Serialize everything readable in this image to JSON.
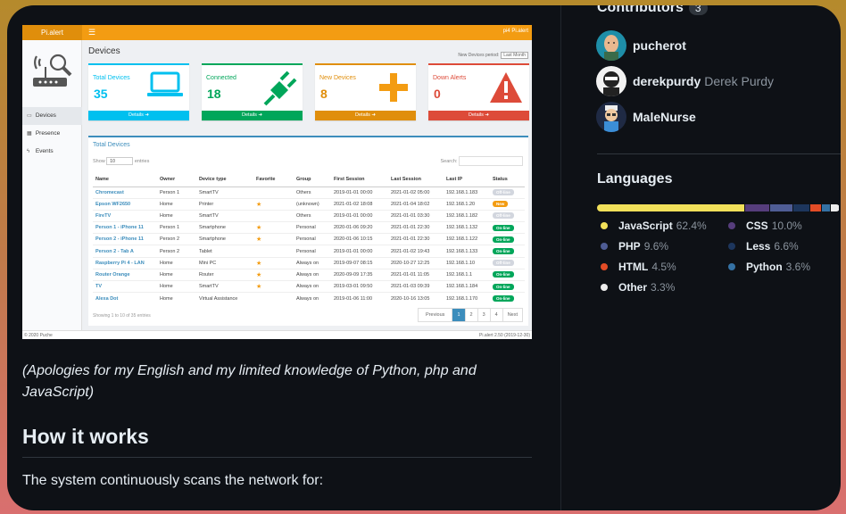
{
  "shot": {
    "brand": "Pi.alert",
    "topbar_right": "pi4   Pi.alert",
    "page_title": "Devices",
    "period_label": "New Devices period:",
    "period_value": "Last Month",
    "nav": [
      {
        "label": "Devices",
        "icon": "laptop-icon"
      },
      {
        "label": "Presence",
        "icon": "calendar-icon"
      },
      {
        "label": "Events",
        "icon": "bolt-icon"
      }
    ],
    "boxes": [
      {
        "label": "Total Devices",
        "value": "35",
        "footer": "Details",
        "color": "#00c0ef"
      },
      {
        "label": "Connected",
        "value": "18",
        "footer": "Details",
        "color": "#00a65a"
      },
      {
        "label": "New Devices",
        "value": "8",
        "footer": "Details",
        "color": "#e08e0b"
      },
      {
        "label": "Down Alerts",
        "value": "0",
        "footer": "Details",
        "color": "#dd4b39"
      }
    ],
    "table_title": "Total Devices",
    "show_label": "Show",
    "show_value": "10",
    "entries_label": "entries",
    "search_label": "Search:",
    "columns": [
      "Name",
      "Owner",
      "Device type",
      "Favorite",
      "Group",
      "First Session",
      "Last Session",
      "Last IP",
      "Status"
    ],
    "rows": [
      {
        "name": "Chromecast",
        "owner": "Person 1",
        "type": "SmartTV",
        "fav": false,
        "group": "Others",
        "first": "2019-01-01  00:00",
        "last": "2021-01-02  05:00",
        "ip": "192.168.1.183",
        "status": "Off-line"
      },
      {
        "name": "Epson WF2650",
        "owner": "Home",
        "type": "Printer",
        "fav": true,
        "group": "(unknown)",
        "first": "2021-01-02  18:08",
        "last": "2021-01-04  18:02",
        "ip": "192.168.1.20",
        "status": "New"
      },
      {
        "name": "FireTV",
        "owner": "Home",
        "type": "SmartTV",
        "fav": false,
        "group": "Others",
        "first": "2019-01-01  00:00",
        "last": "2021-01-01  03:30",
        "ip": "192.168.1.182",
        "status": "Off-line"
      },
      {
        "name": "Person 1 - iPhone 11",
        "owner": "Person 1",
        "type": "Smartphone",
        "fav": true,
        "group": "Personal",
        "first": "2020-01-06  09:20",
        "last": "2021-01-01  22:30",
        "ip": "192.168.1.132",
        "status": "On-line"
      },
      {
        "name": "Person 2 - iPhone 11",
        "owner": "Person 2",
        "type": "Smartphone",
        "fav": true,
        "group": "Personal",
        "first": "2020-01-06  10:15",
        "last": "2021-01-01  22:30",
        "ip": "192.168.1.122",
        "status": "On-line"
      },
      {
        "name": "Person 2 - Tab A",
        "owner": "Person 2",
        "type": "Tablet",
        "fav": false,
        "group": "Personal",
        "first": "2019-01-01  00:00",
        "last": "2021-01-02  19:43",
        "ip": "192.168.1.133",
        "status": "On-line"
      },
      {
        "name": "Raspberry Pi 4 - LAN",
        "owner": "Home",
        "type": "Mini PC",
        "fav": true,
        "group": "Always on",
        "first": "2019-09-07  08:15",
        "last": "2020-10-27  12:25",
        "ip": "192.168.1.10",
        "status": "Off-line"
      },
      {
        "name": "Router Orange",
        "owner": "Home",
        "type": "Router",
        "fav": true,
        "group": "Always on",
        "first": "2020-09-09  17:35",
        "last": "2021-01-01  11:05",
        "ip": "192.168.1.1",
        "status": "On-line"
      },
      {
        "name": "TV",
        "owner": "Home",
        "type": "SmartTV",
        "fav": true,
        "group": "Always on",
        "first": "2019-03-01  09:50",
        "last": "2021-01-03  09:39",
        "ip": "192.168.1.184",
        "status": "On-line"
      },
      {
        "name": "Alexa Dot",
        "owner": "Home",
        "type": "Virtual Assistance",
        "fav": false,
        "group": "Always on",
        "first": "2019-01-06  11:00",
        "last": "2020-10-16  13:05",
        "ip": "192.168.1.170",
        "status": "On-line"
      }
    ],
    "showing": "Showing 1 to 10 of 35 entries",
    "pager": [
      "Previous",
      "1",
      "2",
      "3",
      "4",
      "Next"
    ],
    "footer_left": "© 2020 Puche",
    "footer_right": "Pi.alert  2.50  (2019-12-30)",
    "status_colors": {
      "On-line": "#00a65a",
      "Off-line": "#d2d6de",
      "New": "#f39c12"
    }
  },
  "readme": {
    "apology": "(Apologies for my English and my limited knowledge of Python, php and JavaScript)",
    "heading": "How it works",
    "paragraph": "The system continuously scans the network for:"
  },
  "sidebar": {
    "contributors_title": "Contributors",
    "contributors_count": "3",
    "contributors": [
      {
        "login": "pucherot",
        "fullname": "",
        "avatar": "avatar-pucherot"
      },
      {
        "login": "derekpurdy",
        "fullname": "Derek Purdy",
        "avatar": "avatar-derekpurdy"
      },
      {
        "login": "MaleNurse",
        "fullname": "",
        "avatar": "avatar-malenurse"
      }
    ],
    "languages_title": "Languages",
    "languages": [
      {
        "name": "JavaScript",
        "pct": "62.4%",
        "value": 62.4,
        "color": "#f1e05a"
      },
      {
        "name": "CSS",
        "pct": "10.0%",
        "value": 10.0,
        "color": "#563d7c"
      },
      {
        "name": "PHP",
        "pct": "9.6%",
        "value": 9.6,
        "color": "#4f5d95"
      },
      {
        "name": "Less",
        "pct": "6.6%",
        "value": 6.6,
        "color": "#1d365d"
      },
      {
        "name": "HTML",
        "pct": "4.5%",
        "value": 4.5,
        "color": "#e34c26"
      },
      {
        "name": "Python",
        "pct": "3.6%",
        "value": 3.6,
        "color": "#3572a5"
      },
      {
        "name": "Other",
        "pct": "3.3%",
        "value": 3.3,
        "color": "#ededed"
      }
    ]
  }
}
